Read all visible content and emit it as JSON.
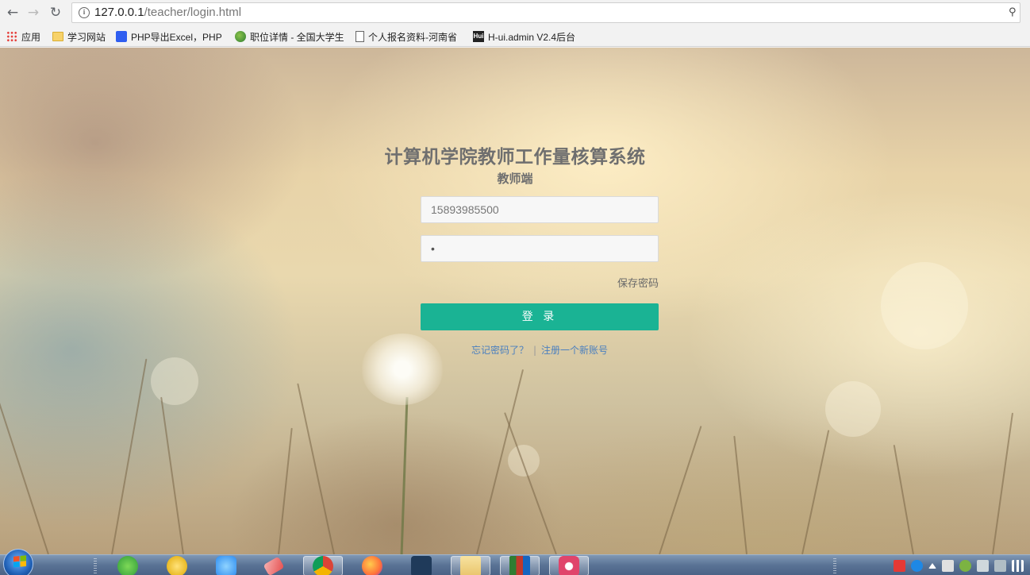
{
  "browser": {
    "url_host": "127.0.0.1",
    "url_path": "/teacher/login.html",
    "bookmarks": [
      {
        "label": "应用",
        "icon": "apps-grid-icon"
      },
      {
        "label": "学习网站",
        "icon": "folder-icon"
      },
      {
        "label": "PHP导出Excel，PHP",
        "icon": "baidu-paw-icon"
      },
      {
        "label": "职位详情 - 全国大学生",
        "icon": "globe-icon"
      },
      {
        "label": "个人报名资料-河南省",
        "icon": "document-icon"
      },
      {
        "label": "H-ui.admin V2.4后台",
        "icon": "hui-icon"
      }
    ],
    "hui_icon_text": "Hui"
  },
  "login": {
    "title": "计算机学院教师工作量核算系统",
    "subtitle": "教师端",
    "username_value": "15893985500",
    "password_value": "•",
    "save_password": "保存密码",
    "login_button": "登 录",
    "forgot_link": "忘记密码了？",
    "separator": "|",
    "register_link": "注册一个新账号"
  },
  "taskbar": {
    "apps": [
      {
        "name": "green-arrow-app-icon",
        "color": "#3cb34a"
      },
      {
        "name": "yellow-app-icon",
        "color": "#f2c12e"
      },
      {
        "name": "baidu-cloud-icon",
        "color": "#2d8cf0"
      },
      {
        "name": "eraser-app-icon",
        "color": "#e55050"
      },
      {
        "name": "chrome-icon",
        "color": "#db4437"
      },
      {
        "name": "firefox-icon",
        "color": "#ff7139"
      },
      {
        "name": "dark-s-app-icon",
        "color": "#1f3a5a"
      },
      {
        "name": "explorer-icon",
        "color": "#e9c46a"
      },
      {
        "name": "winrar-icon",
        "color": "#c0392b"
      },
      {
        "name": "camera-app-icon",
        "color": "#e0456b"
      }
    ]
  }
}
